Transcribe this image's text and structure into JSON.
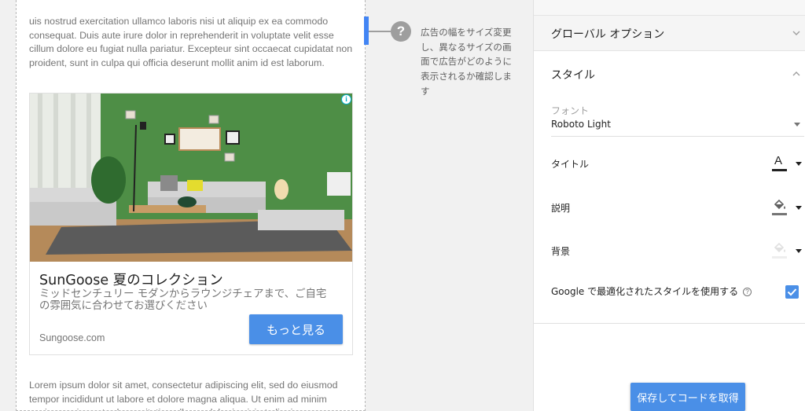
{
  "preview": {
    "lorem_top": "uis nostrud exercitation ullamco laboris nisi ut aliquip ex ea commodo consequat. Duis aute irure dolor in reprehenderit in voluptate velit esse cillum dolore eu fugiat nulla pariatur. Excepteur sint occaecat cupidatat non proident, sunt in culpa qui officia deserunt mollit anim id est laborum.",
    "lorem_bottom": "Lorem ipsum dolor sit amet, consectetur adipiscing elit, sed do eiusmod tempor incididunt ut labore et dolore magna aliqua. Ut enim ad minim veniam, quis nostrud exercitation ullamco laboris nisi ut aliquip ex ea commodo",
    "ad": {
      "info_glyph": "i",
      "title": "SunGoose 夏のコレクション",
      "description": "ミッドセンチュリー モダンからラウンジチェアまで、ご自宅の雰囲気に合わせてお選びください",
      "url": "Sungoose.com",
      "cta_label": "もっと見る"
    }
  },
  "help": {
    "icon_glyph": "?",
    "text": "広告の幅をサイズ変更し、異なるサイズの画面で広告がどのように表示されるか確認します"
  },
  "panel": {
    "global_options": "グローバル オプション",
    "style_section": "スタイル",
    "font_label": "フォント",
    "font_value": "Roboto Light",
    "title_label": "タイトル",
    "title_picker_glyph": "A",
    "description_label": "説明",
    "background_label": "背景",
    "google_optimized_label": "Google で最適化されたスタイルを使用する",
    "google_optimized_checked": true,
    "help_glyph": "?",
    "save_button": "保存してコードを取得"
  },
  "colors": {
    "accent": "#4a8fe7",
    "title_color": "#212121",
    "description_color": "#757575",
    "background_color": "#e0e0e0"
  }
}
